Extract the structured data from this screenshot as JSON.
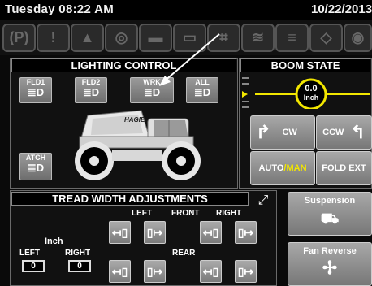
{
  "header": {
    "date_left": "Tuesday 08:22 AM",
    "date_right": "10/22/2013"
  },
  "warning_icons": [
    {
      "name": "parking-brake-icon",
      "glyph": "(P)"
    },
    {
      "name": "warning-diamond-icon",
      "glyph": "!"
    },
    {
      "name": "fluid-level-icon",
      "glyph": "▲"
    },
    {
      "name": "filter-icon",
      "glyph": "◎"
    },
    {
      "name": "engine-icon",
      "glyph": "▬"
    },
    {
      "name": "battery-icon",
      "glyph": "▭"
    },
    {
      "name": "hydraulic-icon",
      "glyph": "⌗"
    },
    {
      "name": "coolant-icon",
      "glyph": "≋"
    },
    {
      "name": "oil-pressure-icon",
      "glyph": "≡"
    },
    {
      "name": "transmission-icon",
      "glyph": "◇"
    },
    {
      "name": "spray-icon",
      "glyph": "◉"
    }
  ],
  "lighting": {
    "title": "LIGHTING CONTROL",
    "buttons": {
      "fld1": "FLD1",
      "fld2": "FLD2",
      "wrk": "WRK",
      "all": "ALL",
      "atch": "ATCH"
    },
    "light_glyph": "≣D",
    "vehicle_brand": "HAGIE"
  },
  "boom": {
    "title": "BOOM STATE",
    "value": "0.0",
    "unit": "Inch",
    "cw": "CW",
    "ccw": "CCW",
    "auto": "AUTO",
    "slash": " / ",
    "man": "MAN",
    "fold_ext": "FOLD EXT"
  },
  "tread": {
    "title": "TREAD WIDTH ADJUSTMENTS",
    "left": "LEFT",
    "front": "FRONT",
    "right": "RIGHT",
    "rear": "REAR",
    "unit_label": "Inch",
    "left_label": "LEFT",
    "right_label": "RIGHT",
    "left_value": "0",
    "right_value": "0",
    "glyphs": [
      "↤▯",
      "▯↦",
      "↤▯",
      "▯↦"
    ]
  },
  "side": {
    "suspension": "Suspension",
    "fan_reverse": "Fan Reverse"
  },
  "colors": {
    "accent_yellow": "#f2e600",
    "button_gray": "#8a8a8a"
  }
}
